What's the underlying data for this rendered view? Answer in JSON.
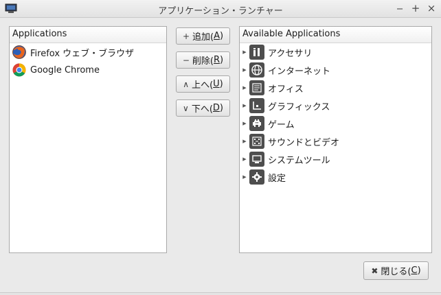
{
  "window": {
    "title": "アプリケーション・ランチャー",
    "minimize_glyph": "‒",
    "maximize_glyph": "+",
    "close_glyph": "×"
  },
  "left_panel": {
    "header": "Applications",
    "items": [
      {
        "label": "Firefox ウェブ・ブラウザ",
        "icon": "firefox-icon"
      },
      {
        "label": "Google Chrome",
        "icon": "chrome-icon"
      }
    ]
  },
  "buttons": {
    "add": {
      "icon": "+",
      "label": "追加(",
      "mnemonic": "A",
      "suffix": ")"
    },
    "remove": {
      "icon": "−",
      "label": "削除(",
      "mnemonic": "R",
      "suffix": ")"
    },
    "up": {
      "icon": "∧",
      "label": "上へ(",
      "mnemonic": "U",
      "suffix": ")"
    },
    "down": {
      "icon": "∨",
      "label": "下へ(",
      "mnemonic": "D",
      "suffix": ")"
    },
    "close": {
      "icon": "✖",
      "label": "閉じる(",
      "mnemonic": "C",
      "suffix": ")"
    }
  },
  "right_panel": {
    "header": "Available Applications",
    "expander_glyph": "▶",
    "categories": [
      {
        "label": "アクセサリ",
        "icon": "accessories-icon"
      },
      {
        "label": "インターネット",
        "icon": "globe-icon"
      },
      {
        "label": "オフィス",
        "icon": "office-icon"
      },
      {
        "label": "グラフィックス",
        "icon": "graphics-icon"
      },
      {
        "label": "ゲーム",
        "icon": "game-icon"
      },
      {
        "label": "サウンドとビデオ",
        "icon": "multimedia-icon"
      },
      {
        "label": "システムツール",
        "icon": "system-tools-icon"
      },
      {
        "label": "設定",
        "icon": "settings-icon"
      }
    ]
  }
}
